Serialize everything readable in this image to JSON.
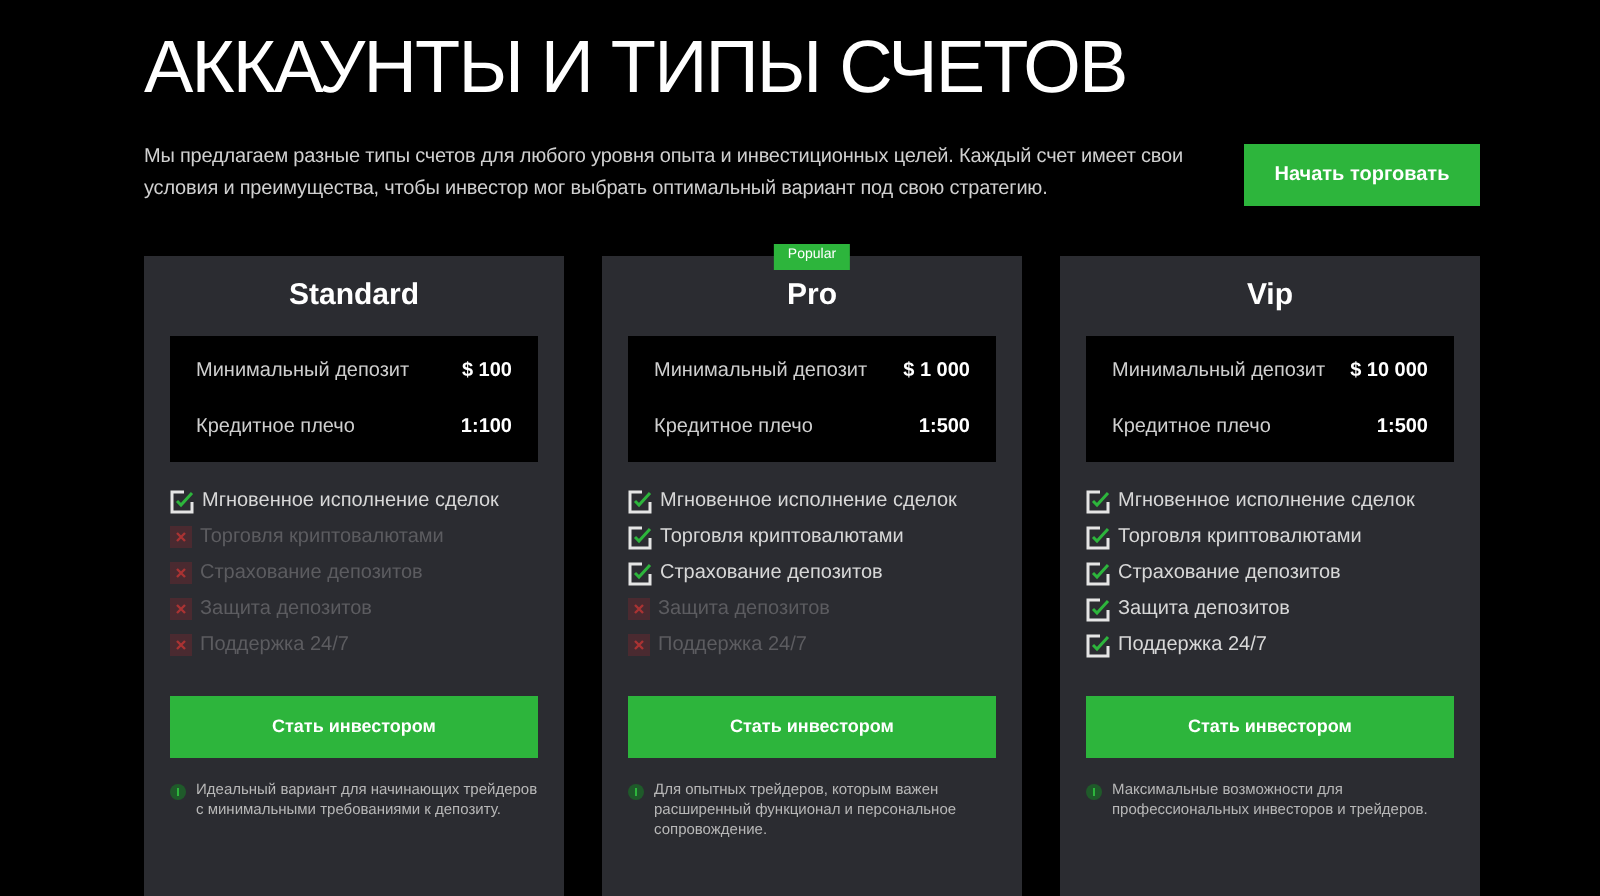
{
  "title": "АККАУНТЫ И ТИПЫ СЧЕТОВ",
  "intro": "Мы предлагаем разные типы счетов для любого уровня опыта и инвестиционных целей. Каждый счет имеет свои условия и преимущества, чтобы инвестор мог выбрать оптимальный вариант под свою стратегию.",
  "cta_button": "Начать торговать",
  "plans": [
    {
      "name": "Standard",
      "deposit_label": "Минимальный депозит",
      "deposit": "$ 100",
      "leverage_label": "Кредитное плечо",
      "leverage": "1:100",
      "features": [
        {
          "label": "Мгновенное исполнение сделок",
          "included": true
        },
        {
          "label": "Торговля криптовалютами",
          "included": false
        },
        {
          "label": "Страхование депозитов",
          "included": false
        },
        {
          "label": "Защита депозитов",
          "included": false
        },
        {
          "label": "Поддержка 24/7",
          "included": false
        }
      ],
      "button": "Стать инвестором",
      "note": "Идеальный вариант для начинающих трейдеров с минимальными требованиями к депозиту."
    },
    {
      "name": "Pro",
      "badge": "Popular",
      "deposit_label": "Минимальный депозит",
      "deposit": "$ 1 000",
      "leverage_label": "Кредитное плечо",
      "leverage": "1:500",
      "features": [
        {
          "label": "Мгновенное исполнение сделок",
          "included": true
        },
        {
          "label": "Торговля криптовалютами",
          "included": true
        },
        {
          "label": "Страхование депозитов",
          "included": true
        },
        {
          "label": "Защита депозитов",
          "included": false
        },
        {
          "label": "Поддержка 24/7",
          "included": false
        }
      ],
      "button": "Стать инвестором",
      "note": "Для опытных трейдеров, которым важен расширенный функционал и персональное сопровождение."
    },
    {
      "name": "Vip",
      "deposit_label": "Минимальный депозит",
      "deposit": "$ 10 000",
      "leverage_label": "Кредитное плечо",
      "leverage": "1:500",
      "features": [
        {
          "label": "Мгновенное исполнение сделок",
          "included": true
        },
        {
          "label": "Торговля криптовалютами",
          "included": true
        },
        {
          "label": "Страхование депозитов",
          "included": true
        },
        {
          "label": "Защита депозитов",
          "included": true
        },
        {
          "label": "Поддержка 24/7",
          "included": true
        }
      ],
      "button": "Стать инвестором",
      "note": "Максимальные возможности для профессиональных инвесторов и трейдеров."
    }
  ]
}
